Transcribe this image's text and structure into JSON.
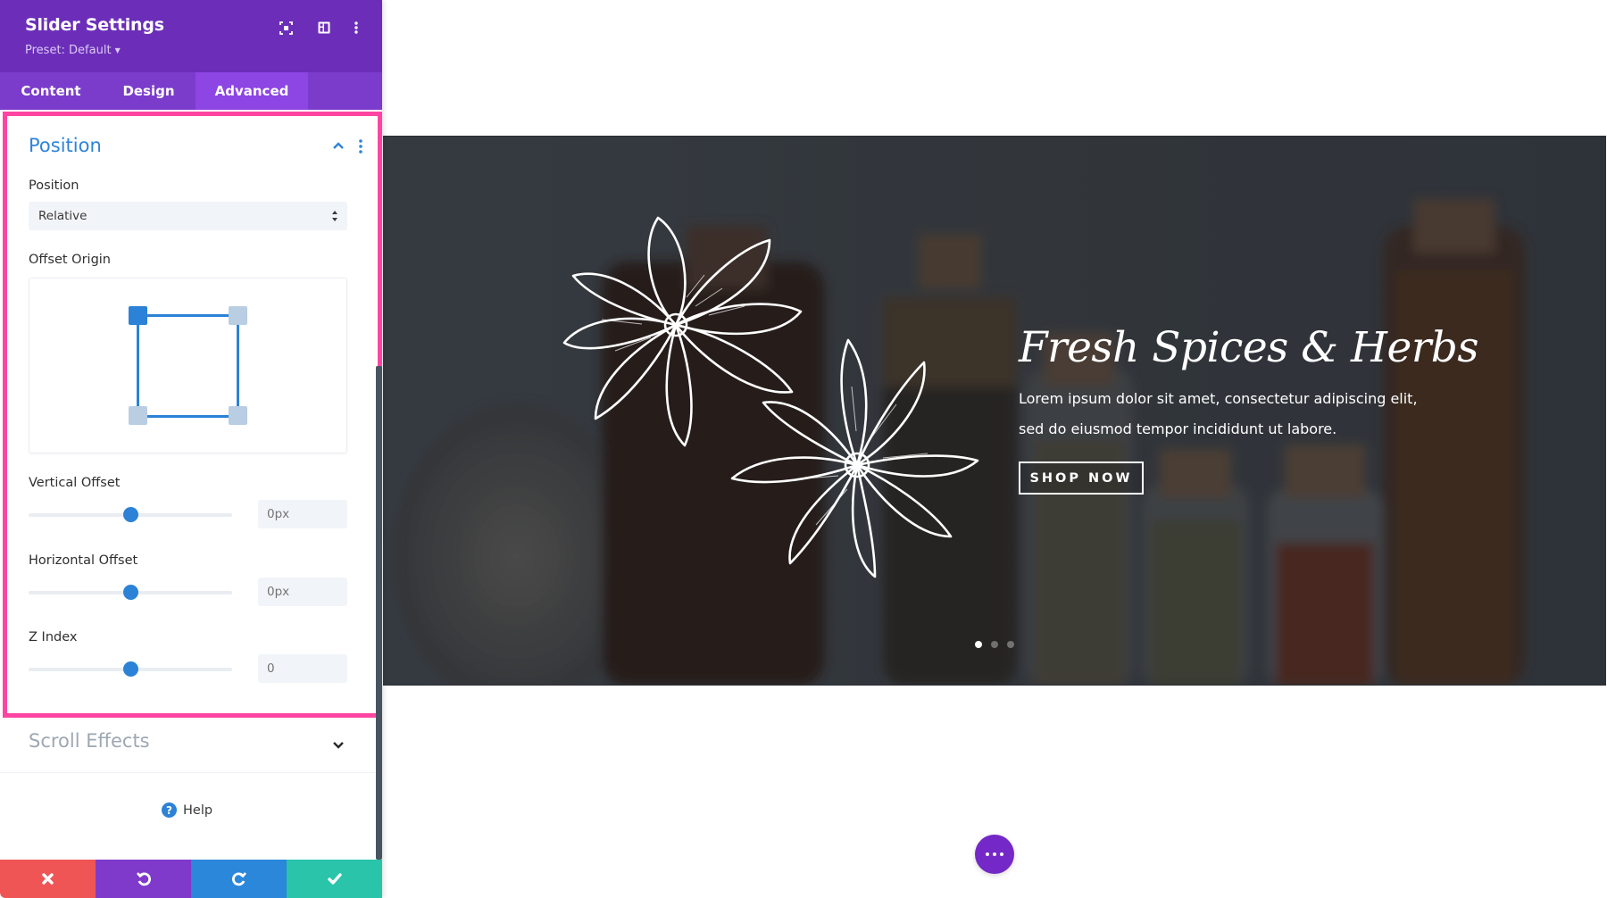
{
  "panel": {
    "title": "Slider Settings",
    "preset_label": "Preset: Default",
    "header_icons": [
      "focus-mode-icon",
      "split-view-icon",
      "more-options-icon"
    ],
    "tabs": [
      {
        "label": "Content",
        "active": false
      },
      {
        "label": "Design",
        "active": false
      },
      {
        "label": "Advanced",
        "active": true
      }
    ],
    "position_section": {
      "title": "Position",
      "expanded": true,
      "position_label": "Position",
      "position_value": "Relative",
      "offset_origin_label": "Offset Origin",
      "offset_origin_selected": "top-left",
      "vertical_offset": {
        "label": "Vertical Offset",
        "value": "0px",
        "slider_fraction": 0.5
      },
      "horizontal_offset": {
        "label": "Horizontal Offset",
        "value": "0px",
        "slider_fraction": 0.5
      },
      "z_index": {
        "label": "Z Index",
        "value": "0",
        "slider_fraction": 0.5
      }
    },
    "scroll_effects": {
      "title": "Scroll Effects",
      "expanded": false
    },
    "help_label": "Help",
    "actions": [
      "cancel",
      "undo",
      "redo",
      "save"
    ]
  },
  "slide": {
    "title": "Fresh Spices & Herbs",
    "description": "Lorem ipsum dolor sit amet, consectetur adipiscing elit, sed do eiusmod tempor incididunt ut labore.",
    "button_label": "SHOP NOW",
    "dots": 3,
    "active_dot": 0
  },
  "colors": {
    "header": "#6c2eb9",
    "tab_bar": "#7b3ccc",
    "active_tab": "#8d45e3",
    "highlight_border": "#ff45a2",
    "accent_blue": "#2b82d6",
    "cancel": "#ef5555",
    "undo": "#7f3acb",
    "redo": "#2b87da",
    "save": "#29c4a9",
    "fab": "#7428c7"
  }
}
